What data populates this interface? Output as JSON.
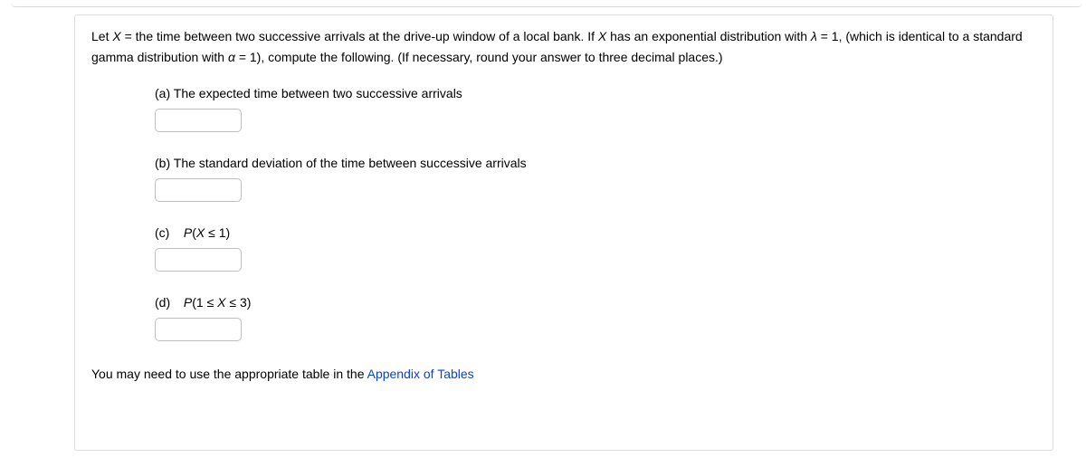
{
  "intro": {
    "p1": "Let ",
    "var1": "X",
    "p2": " = the time between two successive arrivals at the drive-up window of a local bank. If ",
    "var2": "X",
    "p3": " has an exponential distribution with ",
    "var3": "λ",
    "p4": " = 1, (which is identical to a standard gamma distribution with ",
    "var4": "α",
    "p5": " = 1), compute the following. (If necessary, round your answer to three decimal places.)"
  },
  "parts": {
    "a": {
      "letter": "(a)",
      "text": "The expected time between two successive arrivals",
      "value": ""
    },
    "b": {
      "letter": "(b)",
      "text": "The standard deviation of the time between successive arrivals",
      "value": ""
    },
    "c": {
      "letter": "(c)",
      "pre": "P",
      "mid": "(",
      "v1": "X",
      "rel": " ≤ 1)",
      "value": ""
    },
    "d": {
      "letter": "(d)",
      "pre": "P",
      "mid": "(1 ≤ ",
      "v1": "X",
      "rel": " ≤ 3)",
      "value": ""
    }
  },
  "footer": {
    "text": "You may need to use the appropriate table in the ",
    "link": "Appendix of Tables"
  }
}
